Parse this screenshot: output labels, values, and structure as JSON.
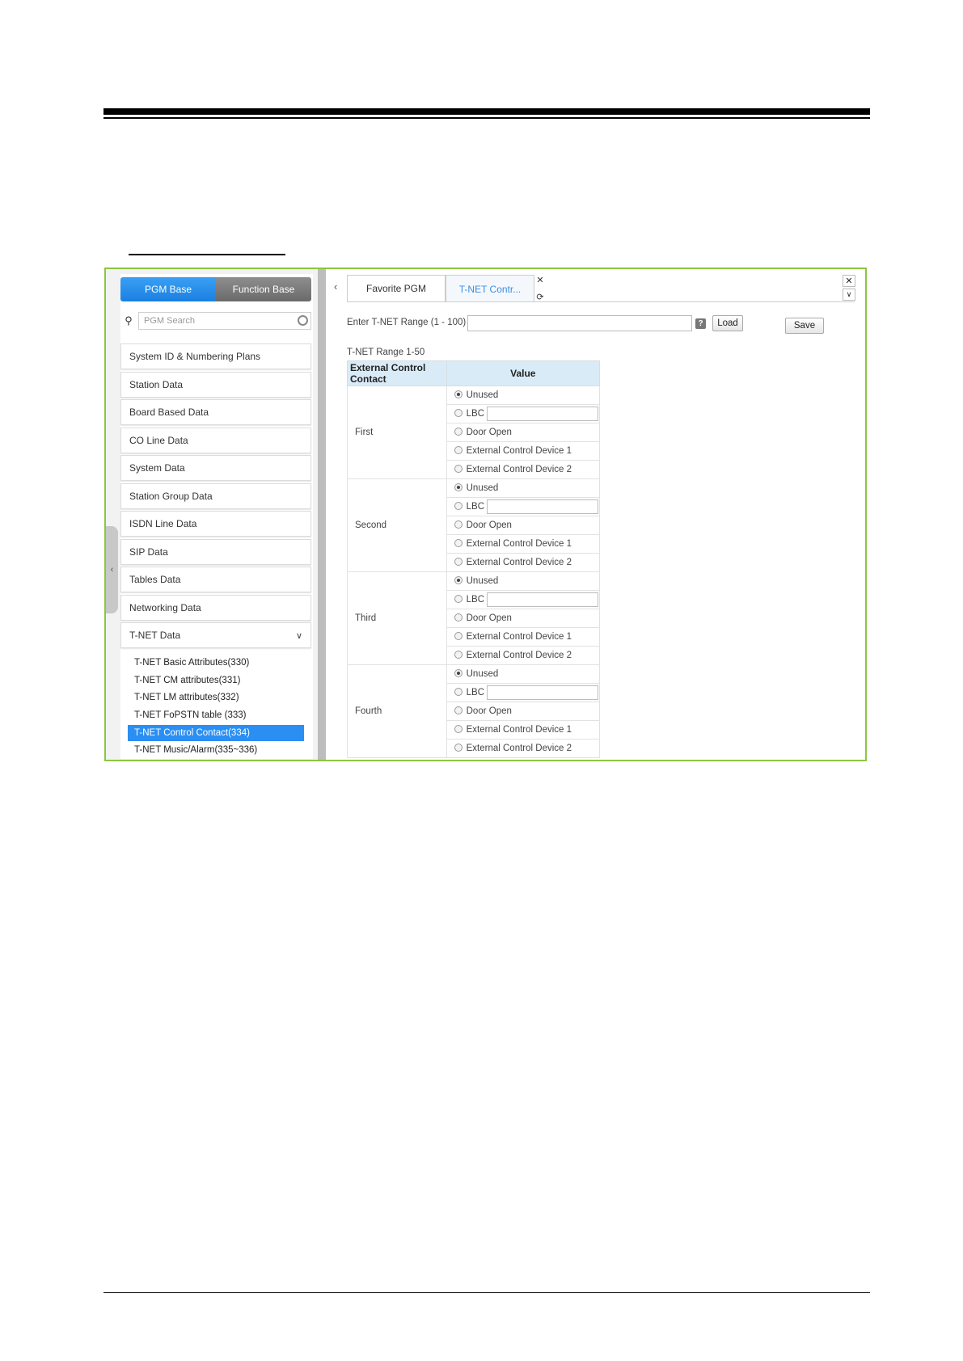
{
  "left_panel": {
    "tabs": {
      "pgm_base": "PGM Base",
      "function_base": "Function Base"
    },
    "search": {
      "placeholder": "PGM Search"
    },
    "menu": [
      "System ID & Numbering Plans",
      "Station Data",
      "Board Based Data",
      "CO Line Data",
      "System Data",
      "Station Group Data",
      "ISDN Line Data",
      "SIP Data",
      "Tables Data",
      "Networking Data"
    ],
    "open_menu": "T-NET Data",
    "submenu": [
      "T-NET Basic Attributes(330)",
      "T-NET CM attributes(331)",
      "T-NET LM attributes(332)",
      "T-NET FoPSTN table (333)",
      "T-NET Control Contact(334)",
      "T-NET Music/Alarm(335~336)"
    ],
    "active_submenu_index": 4
  },
  "right_panel": {
    "tabs": {
      "favorite": "Favorite PGM",
      "current": "T-NET Contr..."
    },
    "range_label": "Enter T-NET Range (1 - 100) :",
    "range_value": "",
    "load_label": "Load",
    "save_label": "Save",
    "range_title": "T-NET Range 1-50",
    "table": {
      "headers": [
        "External Control Contact",
        "Value"
      ],
      "options": [
        "Unused",
        "LBC",
        "Door Open",
        "External Control Device 1",
        "External Control Device 2"
      ],
      "rows": [
        {
          "label": "First",
          "selected": "Unused"
        },
        {
          "label": "Second",
          "selected": "Unused"
        },
        {
          "label": "Third",
          "selected": "Unused"
        },
        {
          "label": "Fourth",
          "selected": "Unused"
        }
      ]
    }
  },
  "colors": {
    "frame_border": "#8cc63f",
    "active_blue": "#2a8ef2",
    "header_bg": "#d9ebf7"
  },
  "icons": [
    "search-icon",
    "clear-icon",
    "chevron-down-icon",
    "chevron-left-icon",
    "close-icon",
    "refresh-icon",
    "help-icon"
  ]
}
